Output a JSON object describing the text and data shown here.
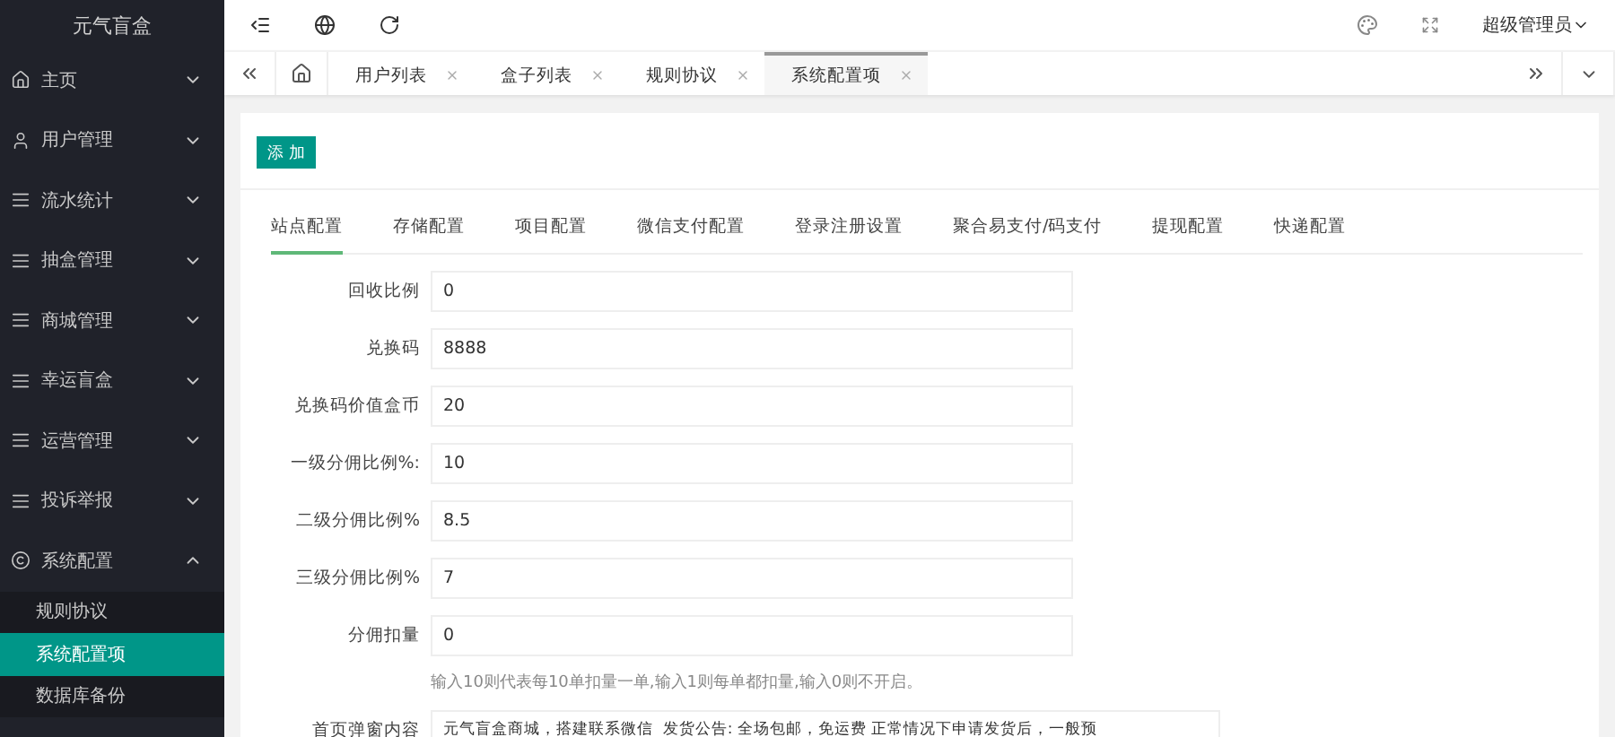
{
  "brand": "元气盲盒",
  "sidebar": {
    "items": [
      {
        "label": "主页",
        "expanded": false
      },
      {
        "label": "用户管理",
        "expanded": false
      },
      {
        "label": "流水统计",
        "expanded": false
      },
      {
        "label": "抽盒管理",
        "expanded": false
      },
      {
        "label": "商城管理",
        "expanded": false
      },
      {
        "label": "幸运盲盒",
        "expanded": false
      },
      {
        "label": "运营管理",
        "expanded": false
      },
      {
        "label": "投诉举报",
        "expanded": false
      },
      {
        "label": "系统配置",
        "expanded": true,
        "children": [
          {
            "label": "规则协议",
            "selected": false
          },
          {
            "label": "系统配置项",
            "selected": true
          },
          {
            "label": "数据库备份",
            "selected": false
          }
        ]
      }
    ]
  },
  "header": {
    "user": "超级管理员"
  },
  "page_tabs": [
    {
      "label": "用户列表",
      "selected": false
    },
    {
      "label": "盒子列表",
      "selected": false
    },
    {
      "label": "规则协议",
      "selected": false
    },
    {
      "label": "系统配置项",
      "selected": true
    }
  ],
  "add_button": "添 加",
  "config_tabs": [
    {
      "label": "站点配置",
      "selected": true
    },
    {
      "label": "存储配置",
      "selected": false
    },
    {
      "label": "项目配置",
      "selected": false
    },
    {
      "label": "微信支付配置",
      "selected": false
    },
    {
      "label": "登录注册设置",
      "selected": false
    },
    {
      "label": "聚合易支付/码支付",
      "selected": false
    },
    {
      "label": "提现配置",
      "selected": false
    },
    {
      "label": "快递配置",
      "selected": false
    }
  ],
  "form": [
    {
      "kind": "input",
      "label": "回收比例",
      "value": "0"
    },
    {
      "kind": "input",
      "label": "兑换码",
      "value": "8888"
    },
    {
      "kind": "input",
      "label": "兑换码价值盒币",
      "value": "20"
    },
    {
      "kind": "input",
      "label": "一级分佣比例%:",
      "value": "10"
    },
    {
      "kind": "input",
      "label": "二级分佣比例%",
      "value": "8.5"
    },
    {
      "kind": "input",
      "label": "三级分佣比例%",
      "value": "7"
    },
    {
      "kind": "input",
      "label": "分佣扣量",
      "value": "0",
      "hint": "输入10则代表每10单扣量一单,输入1则每单都扣量,输入0则不开启。"
    },
    {
      "kind": "textarea",
      "label": "首页弹窗内容",
      "value": "元气盲盒商城，搭建联系微信  发货公告: 全场包邮，免运费 正常情况下申请发货后，一般预"
    }
  ]
}
